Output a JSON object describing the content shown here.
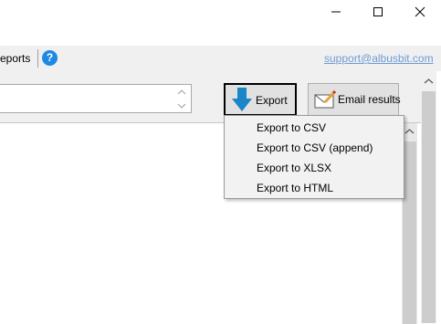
{
  "window": {
    "controls": [
      {
        "name": "minimize",
        "icon": "minimize-icon"
      },
      {
        "name": "maximize",
        "icon": "maximize-icon"
      },
      {
        "name": "close",
        "icon": "close-icon"
      }
    ]
  },
  "menubar": {
    "reports_label": "eports",
    "help_icon": "help-icon",
    "help_glyph": "?",
    "support_link": "support@albusbit.com"
  },
  "toolbar": {
    "export_label": "Export",
    "export_icon": "download-arrow-icon",
    "email_label": "Email results",
    "email_icon": "envelope-pencil-icon"
  },
  "export_menu": {
    "items": [
      {
        "label": "Export to CSV"
      },
      {
        "label": "Export to CSV (append)"
      },
      {
        "label": "Export to XLSX"
      },
      {
        "label": "Export to HTML"
      }
    ]
  },
  "colors": {
    "accent": "#1e88e5",
    "export_arrow": "#1a86c9",
    "link": "#6e9bd4",
    "panel_bg": "#f0f0f0"
  }
}
